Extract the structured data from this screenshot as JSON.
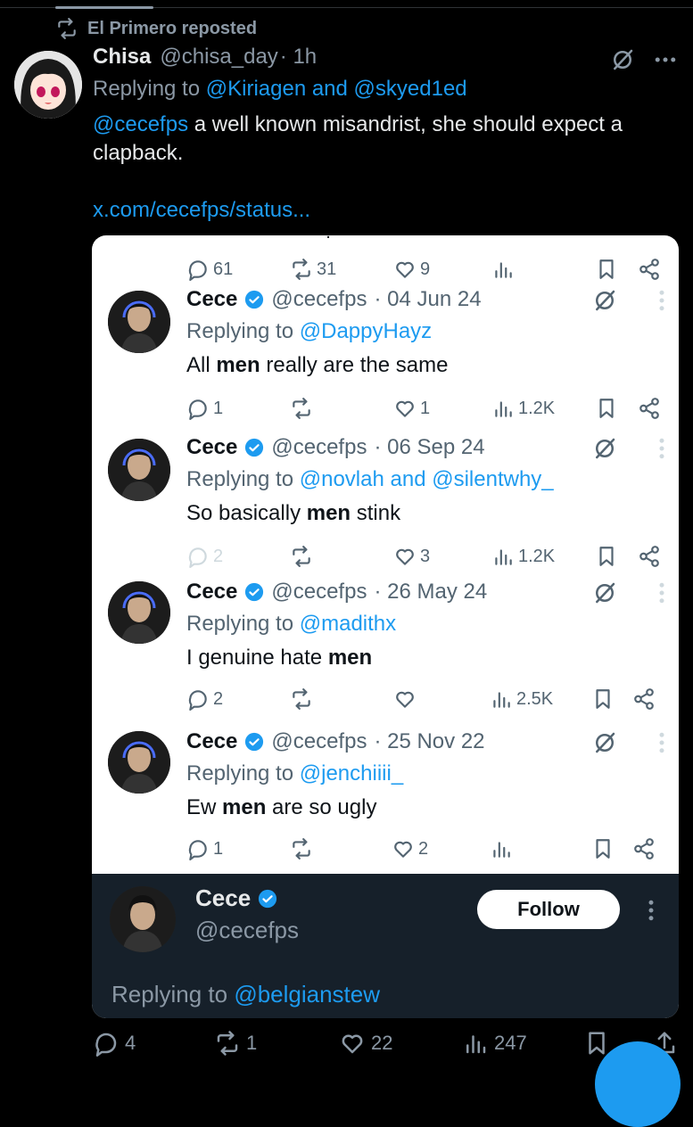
{
  "repost": {
    "label": "El Primero reposted"
  },
  "main_tweet": {
    "name": "Chisa",
    "handle": "@chisa_day",
    "time": "· 1h",
    "reply_prefix": "Replying to",
    "reply_to": "@Kiriagen and @skyed1ed",
    "mention": "@cecefps",
    "text": " a well known misandrist, she should expect a clapback.",
    "url": "x.com/cecefps/status..."
  },
  "card": {
    "top_actions": {
      "replies": "61",
      "reposts": "31",
      "likes": "9"
    },
    "tweets": [
      {
        "name": "Cece",
        "handle": "@cecefps",
        "date": "· 04 Jun 24",
        "reply_prefix": "Replying to",
        "reply_to": "@DappyHayz",
        "text_before": "All ",
        "bold": "men",
        "text_after": " really are the same",
        "replies": "1",
        "reposts": "",
        "likes": "1",
        "views": "1.2K"
      },
      {
        "name": "Cece",
        "handle": "@cecefps",
        "date": "· 06 Sep 24",
        "reply_prefix": "Replying to",
        "reply_to": "@novlah and @silentwhy_",
        "text_before": "So basically ",
        "bold": "men",
        "text_after": " stink",
        "replies": "2",
        "reposts": "",
        "likes": "3",
        "views": "1.2K"
      },
      {
        "name": "Cece",
        "handle": "@cecefps",
        "date": "· 26 May 24",
        "reply_prefix": "Replying to",
        "reply_to": "@madithx",
        "text_before": "I genuine hate ",
        "bold": "men",
        "text_after": "",
        "replies": "2",
        "reposts": "",
        "likes": "",
        "views": "2.5K"
      },
      {
        "name": "Cece",
        "handle": "@cecefps",
        "date": "· 25 Nov 22",
        "reply_prefix": "Replying to",
        "reply_to": "@jenchiiii_",
        "text_before": "Ew ",
        "bold": "men",
        "text_after": " are so ugly",
        "replies": "1",
        "reposts": "",
        "likes": "2",
        "views": ""
      }
    ],
    "panel": {
      "name": "Cece",
      "handle": "@cecefps",
      "follow_label": "Follow",
      "reply_prefix": "Replying to",
      "reply_to": "@belgianstew"
    }
  },
  "bottom_actions": {
    "replies": "4",
    "reposts": "1",
    "likes": "22",
    "views": "247"
  },
  "colors": {
    "accent": "#1d9bf0",
    "muted": "#8b98a5",
    "card_bg": "#ffffff",
    "panel_bg": "#16202a"
  },
  "icons": [
    "repost-icon",
    "grok-icon",
    "more-icon",
    "reply-icon",
    "like-icon",
    "views-icon",
    "bookmark-icon",
    "share-icon",
    "verified-icon"
  ]
}
